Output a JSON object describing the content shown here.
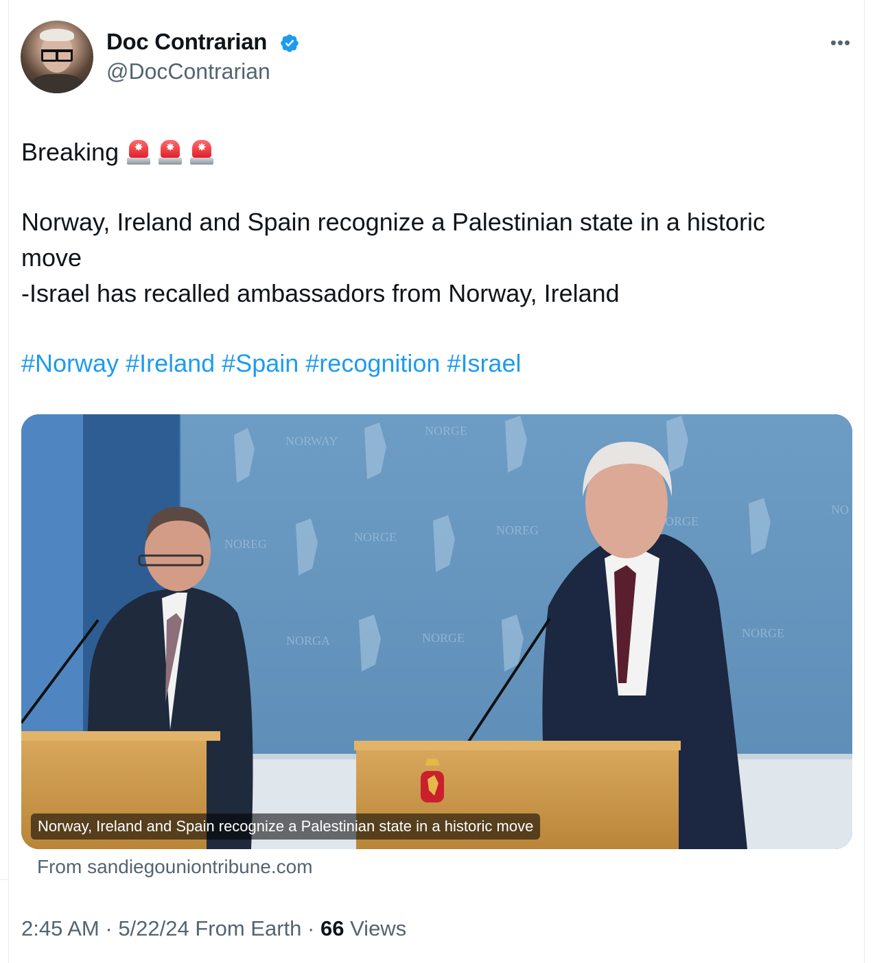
{
  "author": {
    "name": "Doc Contrarian",
    "handle": "@DocContrarian",
    "verified_icon": "verified-badge-icon",
    "accent": "#1d9bf0"
  },
  "post": {
    "breaking": "Breaking",
    "sirens": [
      "🚨",
      "🚨",
      "🚨"
    ],
    "line_a": "Norway, Ireland and Spain recognize a Palestinian state in a historic",
    "line_b": "move",
    "line_c": "-Israel has recalled ambassadors from Norway, Ireland",
    "hashtags": [
      "#Norway",
      "#Ireland",
      "#Spain",
      "#recognition",
      "#Israel"
    ]
  },
  "card": {
    "caption": "Norway, Ireland and Spain recognize a Palestinian state in a historic move",
    "source": "From sandiegouniontribune.com",
    "backdrop_words": [
      "NORWAY",
      "NORGE",
      "NOREG",
      "NORGE",
      "NOREG",
      "NORGE",
      "NORGA",
      "NORGE",
      "NORGE",
      "NO"
    ]
  },
  "meta": {
    "time": "2:45 AM",
    "dot1": " · ",
    "date": "5/22/24",
    "from": " From Earth",
    "dot2": " · ",
    "views_count": "66",
    "views_label": " Views"
  },
  "more_icon": "more-dots-icon"
}
